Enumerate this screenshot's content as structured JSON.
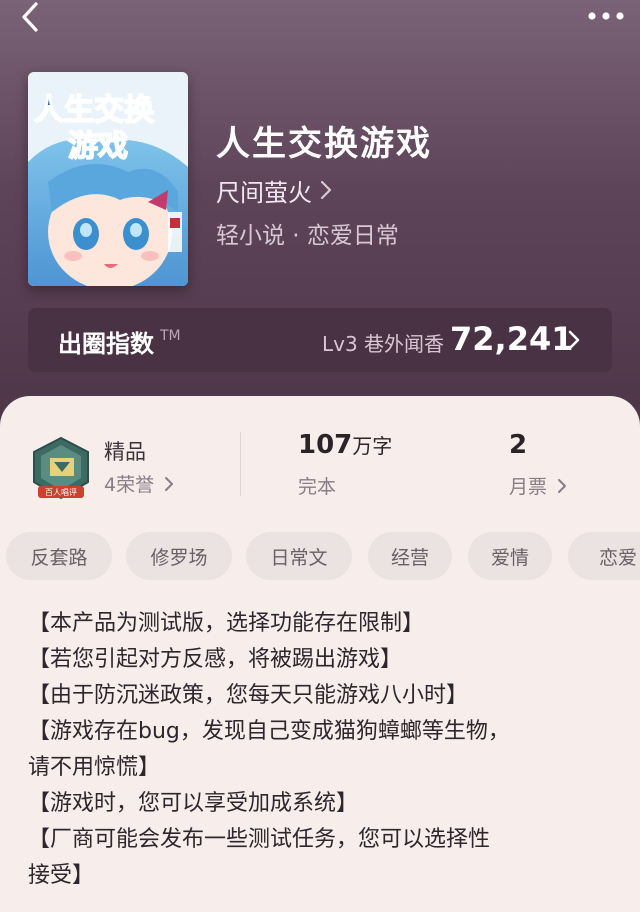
{
  "book": {
    "title": "人生交换游戏",
    "author": "尺间萤火",
    "genre": "轻小说 · 恋爱日常",
    "cover_title_text": "人生交换游戏"
  },
  "index_bar": {
    "label": "出圈指数",
    "tm": "TM",
    "level": "Lv3 巷外闻香",
    "value": "72,241"
  },
  "stats": {
    "quality": {
      "title": "精品",
      "honors": "4荣誉",
      "badge_text": "百人唱评"
    },
    "words": {
      "number": "107",
      "unit": "万字",
      "status": "完本"
    },
    "votes": {
      "number": "2",
      "label": "月票"
    }
  },
  "tags": [
    "反套路",
    "修罗场",
    "日常文",
    "经营",
    "爱情",
    "恋爱"
  ],
  "description_lines": [
    "【本产品为测试版，选择功能存在限制】",
    "【若您引起对方反感，将被踢出游戏】",
    "【由于防沉迷政策，您每天只能游戏八小时】",
    "【游戏存在bug，发现自己变成猫狗蟑螂等生物，",
    "请不用惊慌】",
    "【游戏时，您可以享受加成系统】",
    "【厂商可能会发布一些测试任务，您可以选择性",
    "接受】"
  ],
  "icons": {
    "back": "chevron-left-icon",
    "more": "more-dots-icon",
    "chevron": "chevron-right-icon",
    "badge": "honor-badge-icon"
  },
  "colors": {
    "header_bg": "#5e4459",
    "panel_bg": "#f7eeeb",
    "tag_bg": "#ebe3e2",
    "text_dark": "#2e262c"
  }
}
